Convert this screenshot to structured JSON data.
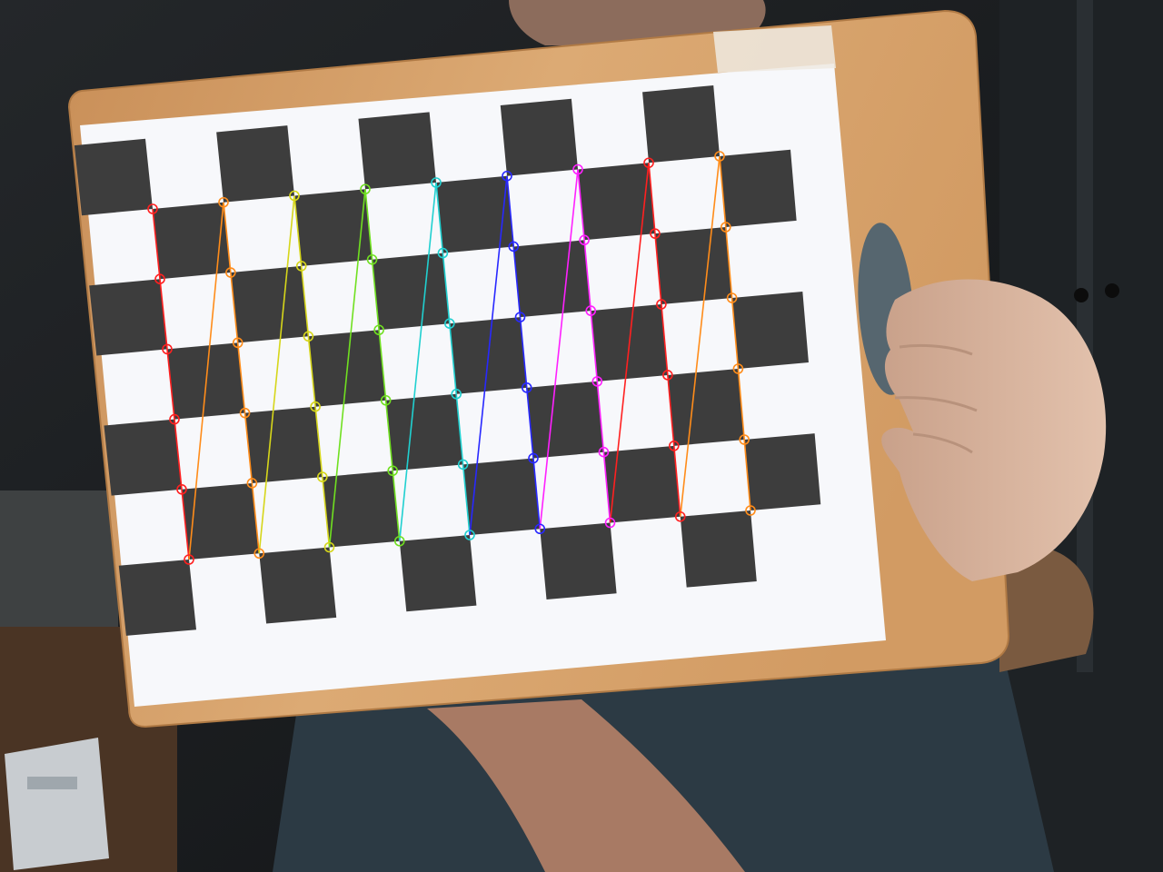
{
  "scene": {
    "kind": "camera-calibration-frame",
    "description_colors": {
      "background": "#1b1d1e",
      "board_wood": "#d9a46e",
      "paper": "#f7f8fb",
      "square": "#3d3d3d",
      "skin": "#d9b29a",
      "shirt": "#2c3a44"
    },
    "checkerboard": {
      "inner_corner_columns": 9,
      "inner_corner_rows": 6,
      "overlay": "detected-corners",
      "column_colors": [
        "#ff2020",
        "#ff8c1a",
        "#d6d61a",
        "#70e020",
        "#20d0d0",
        "#2828ff",
        "#ff20ff",
        "#ff2020",
        "#ff8c1a"
      ]
    }
  }
}
